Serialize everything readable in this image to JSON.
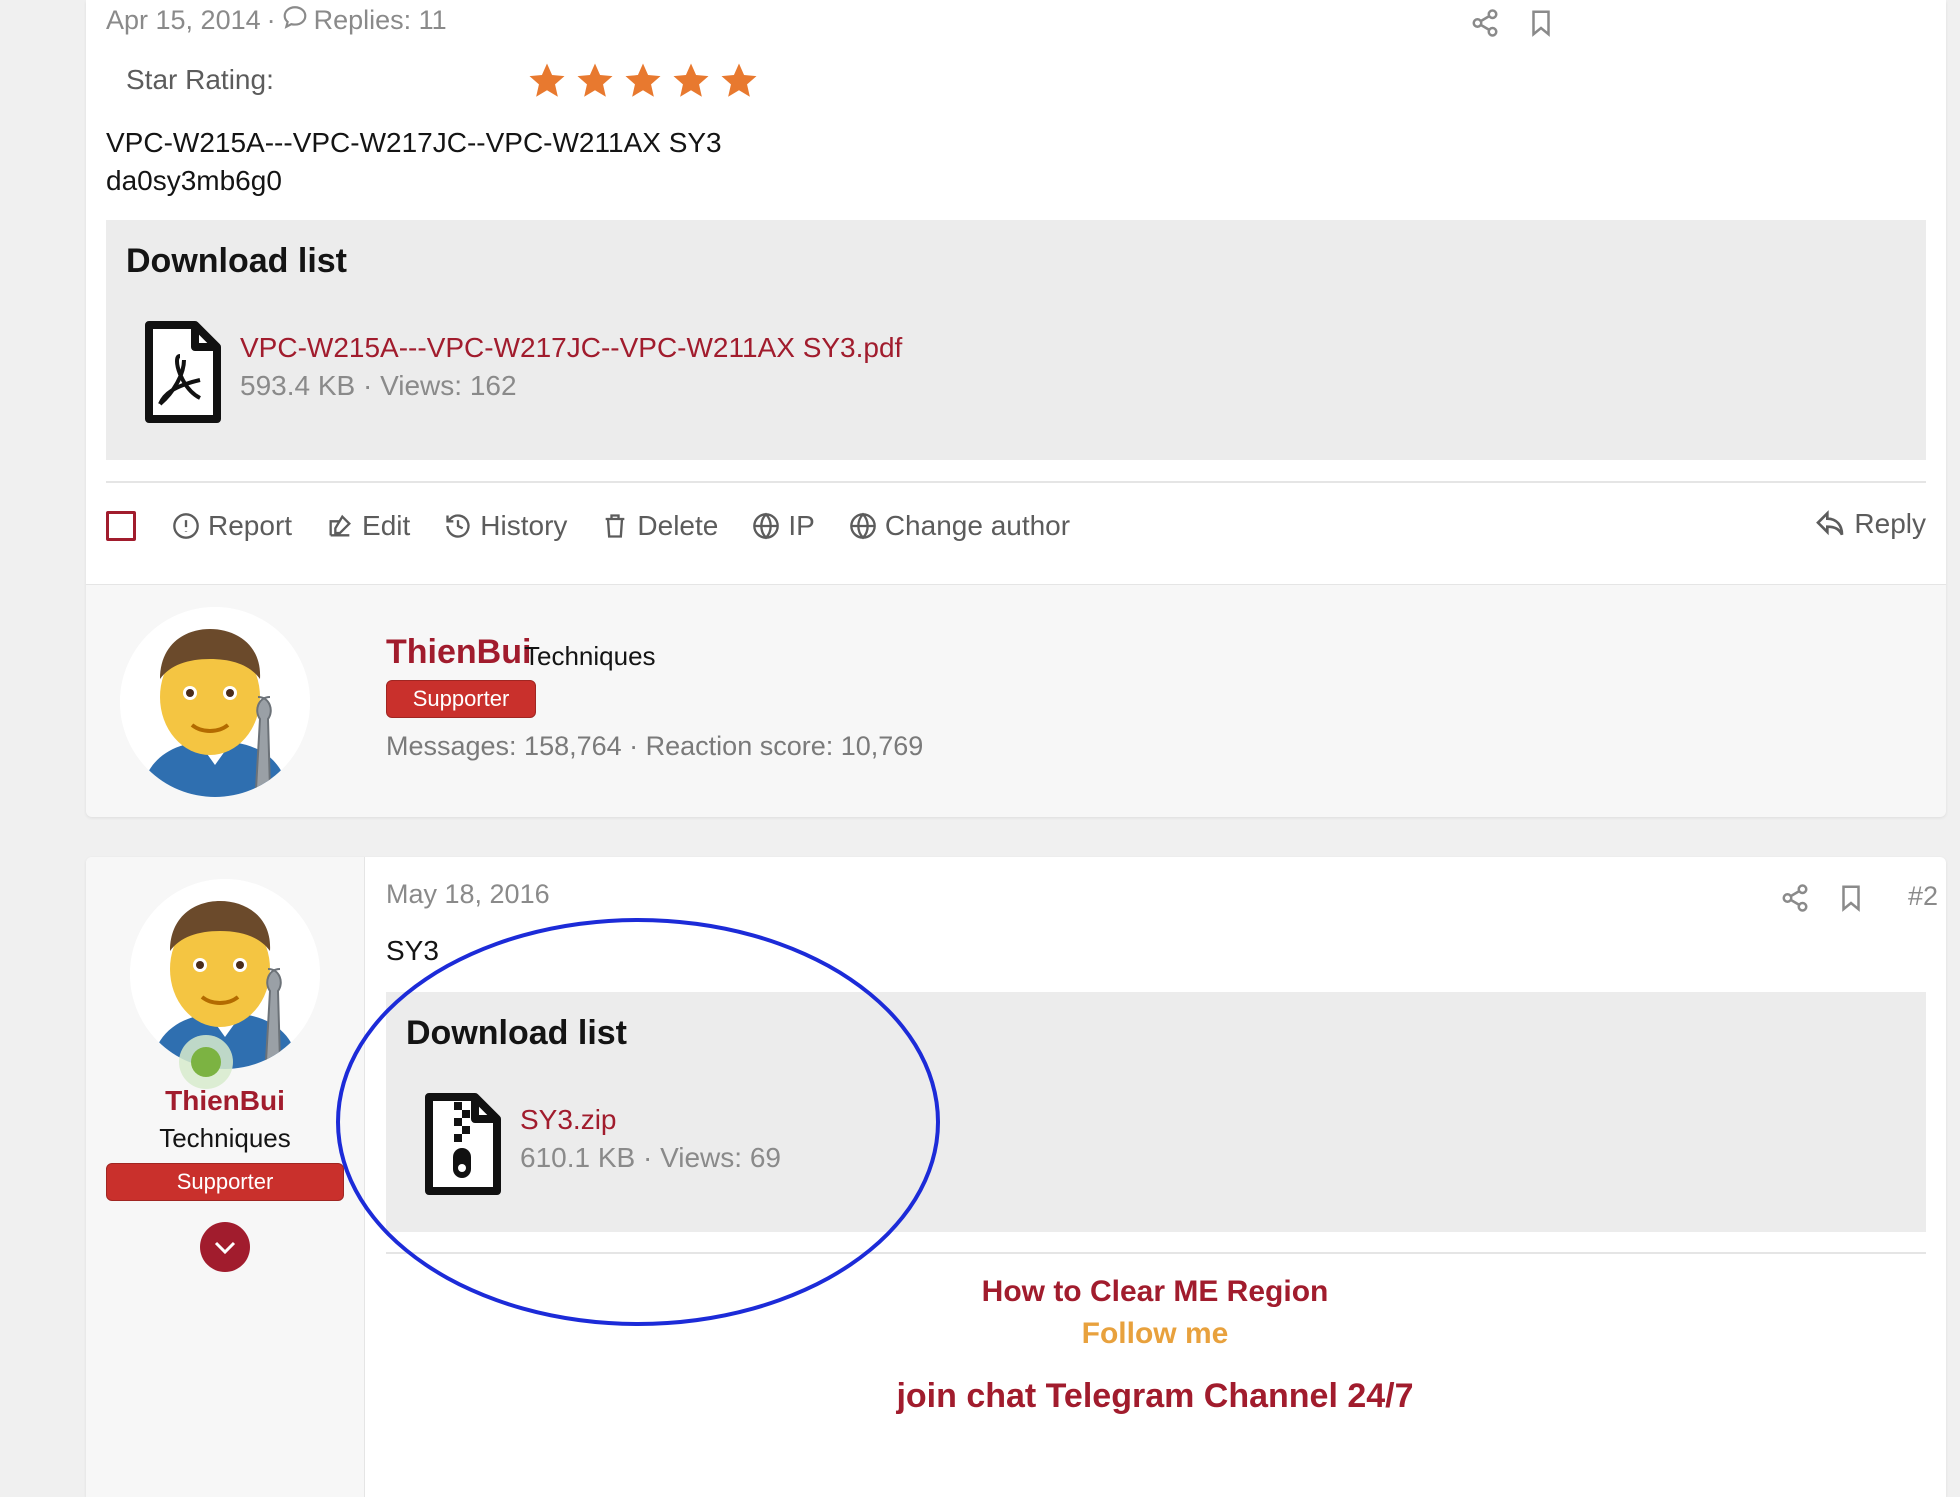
{
  "post1": {
    "date": "Apr 15, 2014",
    "separator": "·",
    "replies": "Replies: 11",
    "star_rating_label": "Star Rating:",
    "rating": 5,
    "rating_max": 5,
    "body_line1": "VPC-W215A---VPC-W217JC--VPC-W211AX SY3",
    "body_line2": "da0sy3mb6g0",
    "download_title": "Download list",
    "file_name": "VPC-W215A---VPC-W217JC--VPC-W211AX SY3.pdf",
    "file_meta": "593.4 KB · Views: 162",
    "actions": {
      "report": "Report",
      "edit": "Edit",
      "history": "History",
      "delete": "Delete",
      "ip": "IP",
      "change_author": "Change author",
      "reply": "Reply"
    },
    "author": {
      "name": "ThienBui",
      "title": "Techniques",
      "badge": "Supporter",
      "stats": "Messages: 158,764 · Reaction score: 10,769"
    }
  },
  "post2": {
    "date": "May 18, 2016",
    "post_number": "#2",
    "body": "SY3",
    "download_title": "Download list",
    "file_name": "SY3.zip",
    "file_meta": "610.1 KB · Views: 69",
    "sidebar": {
      "name": "ThienBui",
      "title": "Techniques",
      "badge": "Supporter"
    },
    "signature": {
      "line1": "How to Clear ME Region",
      "line2": "Follow me",
      "line3": "join chat Telegram Channel 24/7"
    }
  },
  "colors": {
    "accent": "#a11c2d",
    "star": "#e8792f",
    "badge": "#c9302c",
    "follow": "#e8a13d",
    "annotation_circle": "#1c2bd8"
  }
}
